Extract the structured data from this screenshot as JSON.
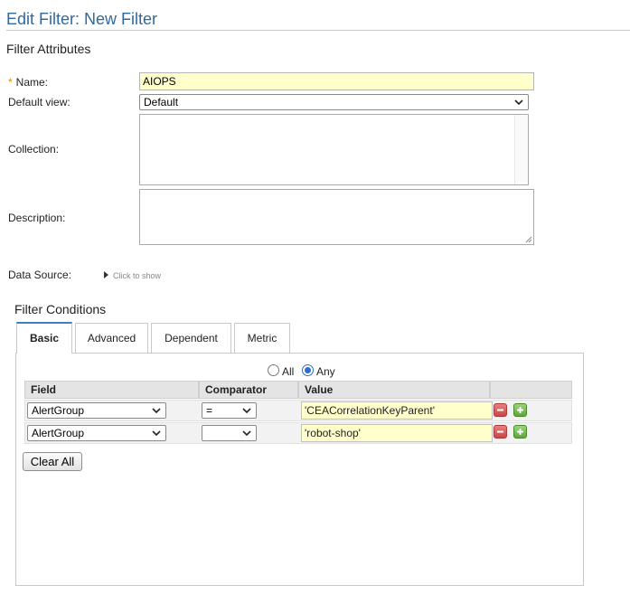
{
  "page": {
    "title": "Edit Filter: New Filter"
  },
  "attributes": {
    "section_title": "Filter Attributes",
    "name_label": "Name:",
    "name_required_mark": "*",
    "name_value": "AIOPS",
    "default_view_label": "Default view:",
    "default_view_value": "Default",
    "collection_label": "Collection:",
    "description_label": "Description:",
    "data_source_label": "Data Source:",
    "data_source_hint": "Click to show"
  },
  "conditions": {
    "section_title": "Filter Conditions",
    "tabs": [
      {
        "label": "Basic",
        "active": true
      },
      {
        "label": "Advanced",
        "active": false
      },
      {
        "label": "Dependent",
        "active": false
      },
      {
        "label": "Metric",
        "active": false
      }
    ],
    "match": {
      "all_label": "All",
      "any_label": "Any",
      "selected": "Any"
    },
    "columns": [
      "Field",
      "Comparator",
      "Value",
      ""
    ],
    "rows": [
      {
        "field": "AlertGroup",
        "comparator": "=",
        "value": "'CEACorrelationKeyParent'"
      },
      {
        "field": "AlertGroup",
        "comparator": "",
        "value": "'robot-shop'"
      }
    ],
    "clear_all_label": "Clear All"
  },
  "colors": {
    "title": "#2f6a9e",
    "input_highlight": "#ffffcc",
    "active_tab_accent": "#3b7fc4",
    "remove_button": "#c94545",
    "add_button": "#5ea63a"
  },
  "icons": {
    "select_arrow": "chevron-down-icon",
    "expand": "triangle-right-icon",
    "remove_row": "minus-icon",
    "add_row": "plus-icon"
  }
}
